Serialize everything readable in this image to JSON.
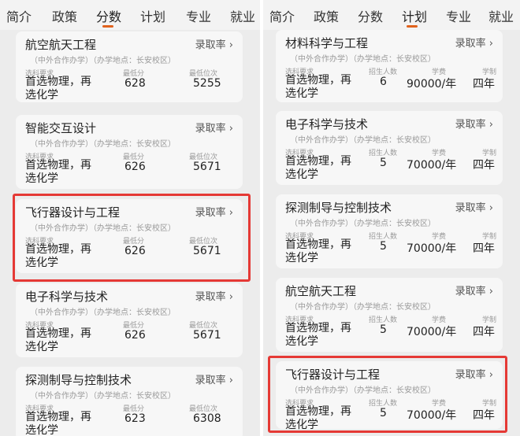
{
  "tabs_left": [
    "简介",
    "政策",
    "分数",
    "计划",
    "专业",
    "就业"
  ],
  "tabs_right": [
    "简介",
    "政策",
    "分数",
    "计划",
    "专业",
    "就业"
  ],
  "rate_label": "录取率 ›",
  "left_cards": [
    {
      "name": "航空航天工程",
      "note": "（中外合作办学）（办学地点：长安校区）",
      "lab_req": "选科要求",
      "lab_score": "最低分",
      "lab_rank": "最低位次",
      "req": "首选物理，再选化学",
      "score": "628",
      "rank": "5255"
    },
    {
      "name": "智能交互设计",
      "note": "（中外合作办学）（办学地点：长安校区）",
      "lab_req": "选科要求",
      "lab_score": "最低分",
      "lab_rank": "最低位次",
      "req": "首选物理，再选化学",
      "score": "626",
      "rank": "5671"
    },
    {
      "name": "飞行器设计与工程",
      "note": "（中外合作办学）（办学地点：长安校区）",
      "lab_req": "选科要求",
      "lab_score": "最低分",
      "lab_rank": "最低位次",
      "req": "首选物理，再选化学",
      "score": "626",
      "rank": "5671"
    },
    {
      "name": "电子科学与技术",
      "note": "（中外合作办学）（办学地点：长安校区）",
      "lab_req": "选科要求",
      "lab_score": "最低分",
      "lab_rank": "最低位次",
      "req": "首选物理，再选化学",
      "score": "626",
      "rank": "5671"
    },
    {
      "name": "探测制导与控制技术",
      "note": "（中外合作办学）（办学地点：长安校区）",
      "lab_req": "选科要求",
      "lab_score": "最低分",
      "lab_rank": "最低位次",
      "req": "首选物理，再选化学",
      "score": "623",
      "rank": "6308"
    }
  ],
  "right_cards": [
    {
      "name": "材料科学与工程",
      "note": "（中外合作办学）（办学地点：长安校区）",
      "lab_req": "选科要求",
      "lab_num": "招生人数",
      "lab_fee": "学费",
      "lab_years": "学制",
      "req": "首选物理，再选化学",
      "num": "6",
      "fee": "90000/年",
      "years": "四年"
    },
    {
      "name": "电子科学与技术",
      "note": "（中外合作办学）（办学地点：长安校区）",
      "lab_req": "选科要求",
      "lab_num": "招生人数",
      "lab_fee": "学费",
      "lab_years": "学制",
      "req": "首选物理，再选化学",
      "num": "5",
      "fee": "70000/年",
      "years": "四年"
    },
    {
      "name": "探测制导与控制技术",
      "note": "（中外合作办学）（办学地点：长安校区）",
      "lab_req": "选科要求",
      "lab_num": "招生人数",
      "lab_fee": "学费",
      "lab_years": "学制",
      "req": "首选物理，再选化学",
      "num": "5",
      "fee": "70000/年",
      "years": "四年"
    },
    {
      "name": "航空航天工程",
      "note": "（中外合作办学）（办学地点：长安校区）",
      "lab_req": "选科要求",
      "lab_num": "招生人数",
      "lab_fee": "学费",
      "lab_years": "学制",
      "req": "首选物理，再选化学",
      "num": "5",
      "fee": "70000/年",
      "years": "四年"
    },
    {
      "name": "飞行器设计与工程",
      "note": "（中外合作办学）（办学地点：长安校区）",
      "lab_req": "选科要求",
      "lab_num": "招生人数",
      "lab_fee": "学费",
      "lab_years": "学制",
      "req": "首选物理，再选化学",
      "num": "5",
      "fee": "70000/年",
      "years": "四年"
    }
  ]
}
